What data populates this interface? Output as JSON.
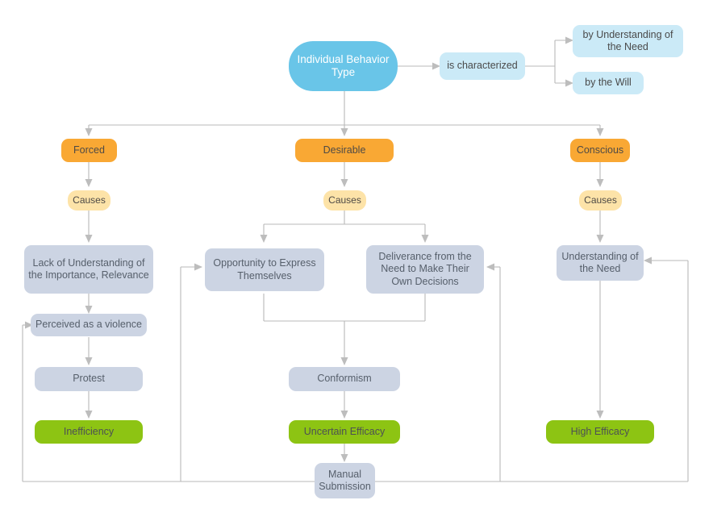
{
  "diagram": {
    "title": "Individual Behavior Type",
    "colors": {
      "root_cyan": "#69c5e8",
      "light_blue": "#cbeaf7",
      "orange": "#f9a834",
      "cream": "#fde3a8",
      "gray_blue": "#ccd4e3",
      "green": "#8dc413",
      "connector_gray": "#b3b3b3",
      "background": "#ffffff"
    },
    "nodes": {
      "root": "Individual Behavior Type",
      "is_characterized": "is characterized",
      "by_understanding": "by Understanding of the Need",
      "by_the_will": "by the Will",
      "forced": "Forced",
      "desirable": "Desirable",
      "conscious": "Conscious",
      "causes_left": "Causes",
      "causes_mid": "Causes",
      "causes_right": "Causes",
      "lack_of_understanding": "Lack of Understanding of the Importance, Relevance",
      "opportunity_to_express": "Opportunity to Express Themselves",
      "deliverance_from_need": "Deliverance from the Need to Make Their Own Decisions",
      "understanding_of_need": "Understanding of the Need",
      "perceived_violence": "Perceived as a violence",
      "conformism": "Conformism",
      "protest": "Protest",
      "inefficiency": "Inefficiency",
      "uncertain_efficacy": "Uncertain Efficacy",
      "high_efficacy": "High Efficacy",
      "manual_submission": "Manual Submission"
    }
  }
}
